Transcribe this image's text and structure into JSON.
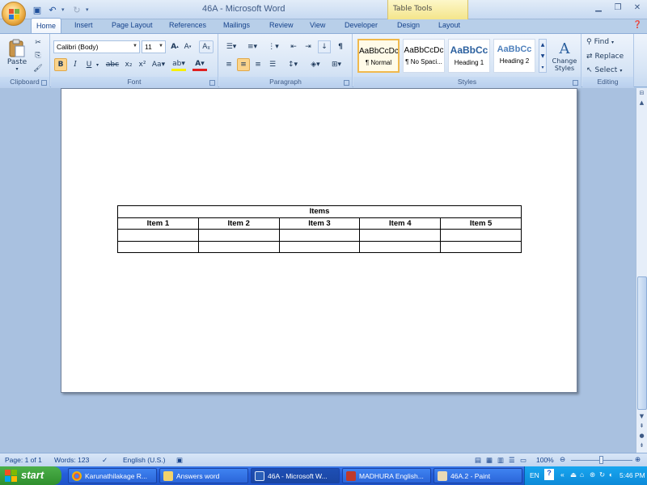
{
  "window": {
    "title": "46A - Microsoft Word",
    "contextual_tab_group": "Table Tools"
  },
  "tabs": [
    "Home",
    "Insert",
    "Page Layout",
    "References",
    "Mailings",
    "Review",
    "View",
    "Developer",
    "Design",
    "Layout"
  ],
  "active_tab": "Home",
  "ribbon": {
    "clipboard": {
      "label": "Clipboard",
      "paste": "Paste"
    },
    "font": {
      "label": "Font",
      "font_name": "Calibri (Body)",
      "font_size": "11"
    },
    "paragraph": {
      "label": "Paragraph"
    },
    "styles": {
      "label": "Styles",
      "items": [
        {
          "preview": "AaBbCcDc",
          "name": "¶ Normal"
        },
        {
          "preview": "AaBbCcDc",
          "name": "¶ No Spaci..."
        },
        {
          "preview": "AaBbCc",
          "name": "Heading 1"
        },
        {
          "preview": "AaBbCc",
          "name": "Heading 2"
        }
      ],
      "change_styles": "Change Styles"
    },
    "editing": {
      "label": "Editing",
      "find": "Find",
      "replace": "Replace",
      "select": "Select"
    }
  },
  "document": {
    "table": {
      "title": "Items",
      "headers": [
        "Item 1",
        "Item 2",
        "Item 3",
        "Item 4",
        "Item 5"
      ],
      "rows": [
        [
          "",
          "",
          "",
          "",
          ""
        ],
        [
          "",
          "",
          "",
          "",
          ""
        ]
      ]
    }
  },
  "status": {
    "page": "Page: 1 of 1",
    "words": "Words: 123",
    "language": "English (U.S.)",
    "zoom": "100%"
  },
  "taskbar": {
    "start": "start",
    "tasks": [
      "Karunathilakage R...",
      "Answers word",
      "46A - Microsoft W...",
      "MADHURA English...",
      "46A.2 - Paint"
    ],
    "lang": "EN",
    "clock": "5:46 PM"
  },
  "colors": {
    "accent": "#15428b",
    "task_bar": "#245edb",
    "start_green": "#3a9c37"
  }
}
